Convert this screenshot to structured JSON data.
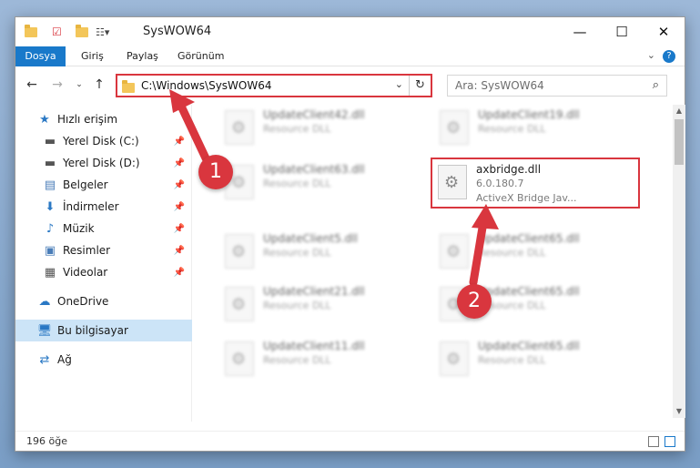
{
  "window": {
    "title": "SysWOW64",
    "minimize_glyph": "—",
    "maximize_glyph": "☐",
    "close_glyph": "✕"
  },
  "ribbon": {
    "tabs": [
      "Dosya",
      "Giriş",
      "Paylaş",
      "Görünüm"
    ],
    "help_glyph": "?"
  },
  "nav": {
    "address_path": "C:\\Windows\\SysWOW64",
    "search_placeholder": "Ara: SysWOW64"
  },
  "sidebar": {
    "items": [
      {
        "label": "Hızlı erişim",
        "icon": "star-icon"
      },
      {
        "label": "Yerel Disk (C:)",
        "icon": "drive-icon"
      },
      {
        "label": "Yerel Disk (D:)",
        "icon": "drive-icon"
      },
      {
        "label": "Belgeler",
        "icon": "documents-icon"
      },
      {
        "label": "İndirmeler",
        "icon": "download-icon"
      },
      {
        "label": "Müzik",
        "icon": "music-icon"
      },
      {
        "label": "Resimler",
        "icon": "pictures-icon"
      },
      {
        "label": "Videolar",
        "icon": "videos-icon"
      },
      {
        "label": "OneDrive",
        "icon": "cloud-icon"
      },
      {
        "label": "Bu bilgisayar",
        "icon": "computer-icon"
      },
      {
        "label": "Ağ",
        "icon": "network-icon"
      }
    ]
  },
  "files": {
    "left": [
      {
        "name": "UpdateClient42.dll",
        "type": "Resource DLL"
      },
      {
        "name": "UpdateClient63.dll",
        "type": "Resource DLL"
      },
      {
        "name": "UpdateClient5.dll",
        "type": "Resource DLL"
      },
      {
        "name": "UpdateClient21.dll",
        "type": "Resource DLL"
      },
      {
        "name": "UpdateClient11.dll",
        "type": "Resource DLL"
      }
    ],
    "right": [
      {
        "name": "UpdateClient19.dll",
        "type": "Resource DLL"
      },
      {
        "name": "UpdateClient65.dll",
        "type": "Resource DLL"
      },
      {
        "name": "UpdateClient65.dll",
        "type": "Resource DLL"
      },
      {
        "name": "UpdateClient65.dll",
        "type": "Resource DLL"
      }
    ],
    "highlight": {
      "name": "axbridge.dll",
      "version": "6.0.180.7",
      "description": "ActiveX Bridge  Jav..."
    }
  },
  "status": {
    "item_count": "196 öğe"
  },
  "annotations": {
    "step1": "1",
    "step2": "2",
    "color": "#d9363e"
  }
}
